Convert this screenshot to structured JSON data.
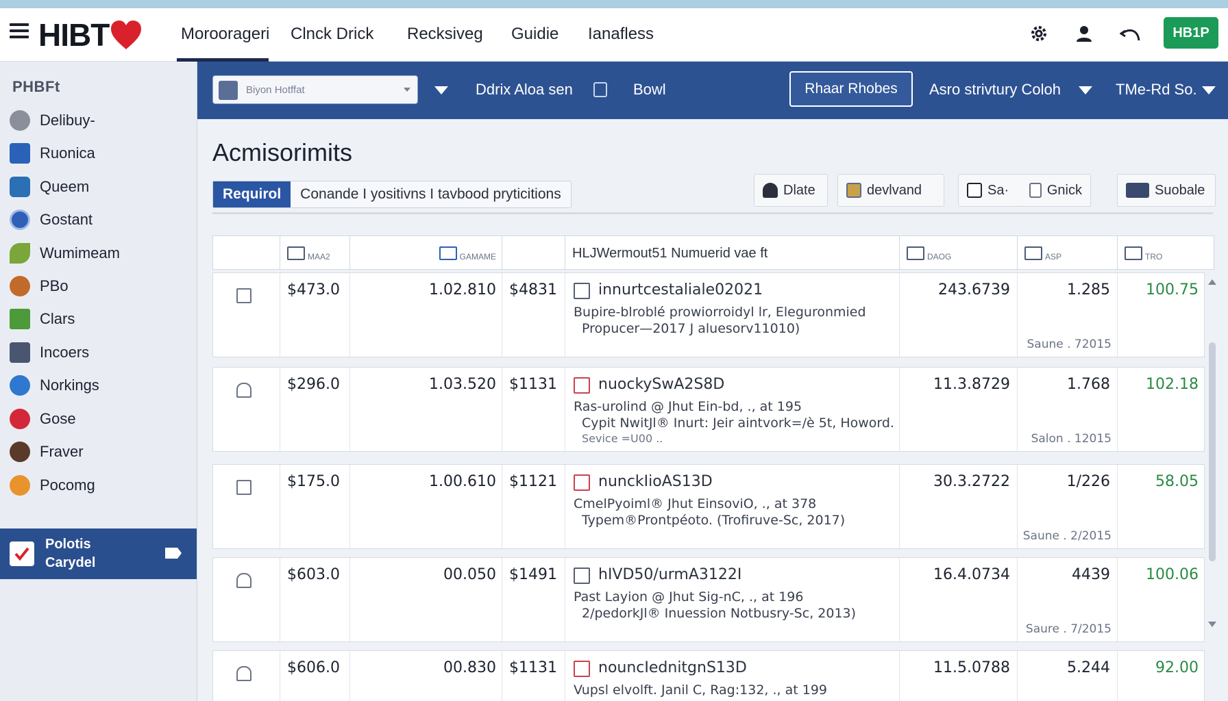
{
  "brand": {
    "name": "HIBT",
    "heart_icon": "heart-icon",
    "heart_color": "#d9212b"
  },
  "topnav": {
    "links": [
      "Moroorageri",
      "Clnck Drick",
      "Recksiveg",
      "Guidie",
      "Ianafless"
    ],
    "active_index": 0,
    "action_button": "HB1P",
    "icons": [
      "gear-icon",
      "user-icon",
      "undo-icon"
    ]
  },
  "sidebar": {
    "heading": "PHBFt",
    "items": [
      {
        "label": "Delibuy-",
        "icon": "trophy-icon",
        "color": "#8a8f99"
      },
      {
        "label": "Ruonica",
        "icon": "n-icon",
        "color": "#2a62b8"
      },
      {
        "label": "Queem",
        "icon": "mountain-icon",
        "color": "#2b6fb5"
      },
      {
        "label": "Gostant",
        "icon": "globe-icon",
        "color": "#2f5fb8"
      },
      {
        "label": "Wumimeam",
        "icon": "leaf-icon",
        "color": "#7aa63a"
      },
      {
        "label": "PBo",
        "icon": "ball-icon",
        "color": "#c26a2a"
      },
      {
        "label": "Clars",
        "icon": "flag-icon",
        "color": "#4c9a3a"
      },
      {
        "label": "Incoers",
        "icon": "box-icon",
        "color": "#4a5670"
      },
      {
        "label": "Norkings",
        "icon": "globe-icon",
        "color": "#2f77cf"
      },
      {
        "label": "Gose",
        "icon": "pin-icon",
        "color": "#d3283a"
      },
      {
        "label": "Fraver",
        "icon": "person-icon",
        "color": "#5a3a2a"
      },
      {
        "label": "Pocomg",
        "icon": "sun-icon",
        "color": "#e8932c"
      }
    ],
    "active_item": {
      "line1": "Polotis",
      "line2": "Carydel",
      "icon": "check-icon"
    }
  },
  "toolbar": {
    "select_placeholder": "Biyon Hotffat",
    "link1": "Ddrix Aloa sen",
    "link2": "Bowl",
    "button": "Rhaar Rhobes",
    "dropdown1": "Asro strivtury Coloh",
    "dropdown2": "TMe-Rd So."
  },
  "main": {
    "title": "Acmisorimits",
    "chip_primary": "Requirol",
    "chip_secondary": "Conande I yositivns I tavbood pryticitions",
    "actions": [
      {
        "label": "Dlate",
        "icon": "person-icon"
      },
      {
        "label": "devlvand",
        "icon": "image-icon"
      },
      {
        "label": "Sa·",
        "icon": "flag-icon"
      },
      {
        "label": "Gnick",
        "icon": "calendar-icon"
      },
      {
        "label": "Suobale",
        "icon": "monitor-icon"
      }
    ]
  },
  "table": {
    "headers": [
      "",
      "MAA2",
      "GAMAME",
      "",
      "HLJWermout51 Numuerid vae ft",
      "DAOG",
      "ASP",
      "TRO"
    ],
    "rows": [
      {
        "price": "$473.0",
        "ratio": "1.02.810",
        "amount": "$4831",
        "title": "innurtcestaliale02021",
        "line1": "Bupire-blroblé prowiorroidyl lr, Eleguronmied",
        "line2": "Propucer—2017 J aluesorv11010)",
        "line3": "",
        "value": "243.6739",
        "score": "1.285",
        "note": "Saune . 72015",
        "pct": "100.75"
      },
      {
        "price": "$296.0",
        "ratio": "1.03.520",
        "amount": "$1131",
        "title": "nuockySwA2S8D",
        "line1": "Ras-urolind @ Jhut Ein-bd, ., at 195",
        "line2": "Cypit NwitJl® Inurt: Jeir aintvork=/è 5t, Howord.",
        "line3": "Sevice =U00 ..",
        "value": "11.3.8729",
        "score": "1.768",
        "note": "Salon . 12015",
        "pct": "102.18"
      },
      {
        "price": "$175.0",
        "ratio": "1.00.610",
        "amount": "$1121",
        "title": "nunckIioAS13D",
        "line1": "CmelPyoiml® Jhut EinsoviO, ., at 378",
        "line2": "Typem®Prontpéoto. (Trofiruve-Sc, 2017)",
        "line3": "",
        "value": "30.3.2722",
        "score": "1/226",
        "note": "Saune . 2/2015",
        "pct": "58.05"
      },
      {
        "price": "$603.0",
        "ratio": "00.050",
        "amount": "$1491",
        "title": "hIVD50/urmA3122I",
        "line1": "Past Layion @ Jhut Sig-nC, ., at 196",
        "line2": "2/pedorkJl® Inuession Notbusry-Sc, 2013)",
        "line3": "",
        "value": "16.4.0734",
        "score": "4439",
        "note": "Saure . 7/2015",
        "pct": "100.06"
      },
      {
        "price": "$606.0",
        "ratio": "00.830",
        "amount": "$1131",
        "title": "nouncIednitgnS13D",
        "line1": "Vupsl elvolft. Janil C, Rag:132, ., at 199",
        "line2": "",
        "line3": "",
        "value": "11.5.0788",
        "score": "5.244",
        "note": "",
        "pct": "92.00"
      }
    ]
  },
  "colors": {
    "toolbar": "#2d5292",
    "accent": "#2a56a4",
    "green": "#1b9b57",
    "positive": "#2a8a44"
  }
}
